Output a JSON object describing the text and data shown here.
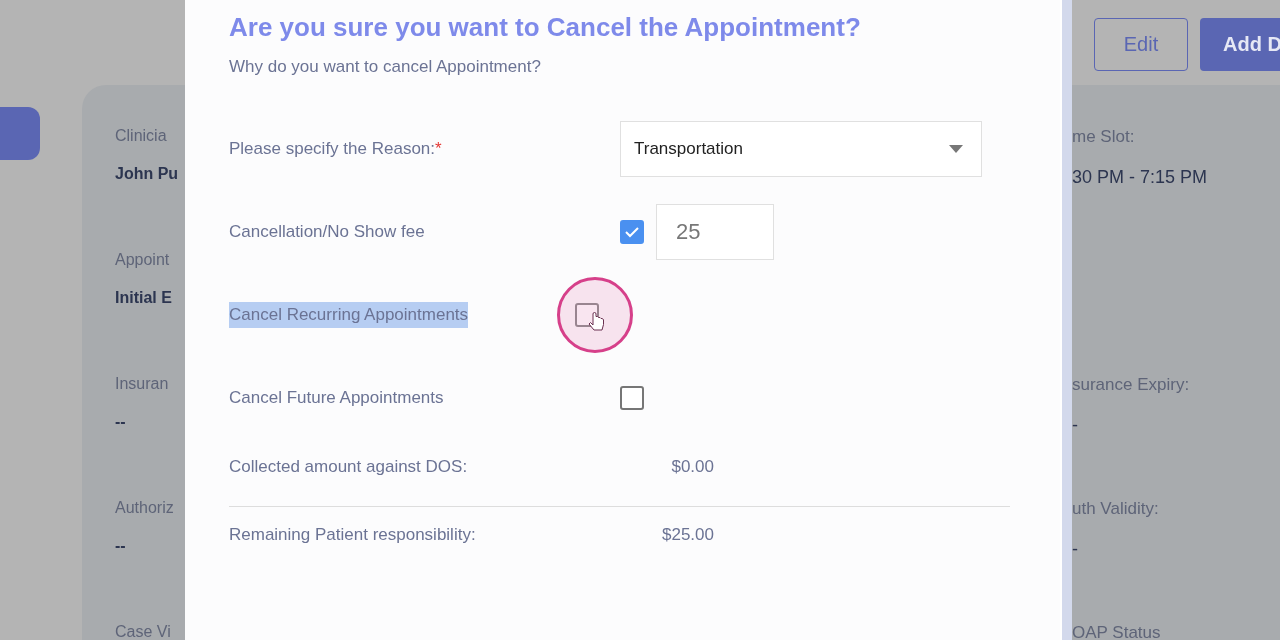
{
  "header_buttons": [
    {
      "label": "Edit",
      "kind": "outline"
    },
    {
      "label": "Add D",
      "kind": "primary"
    }
  ],
  "card_left": [
    {
      "label": "Clinicia",
      "value": "John Pu"
    },
    {
      "label": "Appoint",
      "value": "Initial E"
    },
    {
      "label": "Insuran",
      "value": "--"
    },
    {
      "label": "Authoriz",
      "value": "--"
    },
    {
      "label": "Case Vi"
    }
  ],
  "card_right": [
    {
      "label": "me Slot:",
      "value": "30 PM - 7:15 PM"
    },
    {
      "label": "surance Expiry:",
      "value": "-"
    },
    {
      "label": "uth Validity:",
      "value": "-"
    },
    {
      "label": "OAP Status"
    }
  ],
  "dialog": {
    "title": "Are you sure you want to Cancel the Appointment?",
    "subtitle": "Why do you want to cancel Appointment?",
    "fields": [
      {
        "kind": "select",
        "label": "Please specify the Reason:",
        "required_mark": "*",
        "value": "Transportation"
      },
      {
        "kind": "checkbox_input",
        "label": "Cancellation/No Show fee",
        "checked": true,
        "value": "25"
      },
      {
        "kind": "checkbox",
        "label": "Cancel Recurring Appointments",
        "checked": false,
        "highlighted": true
      },
      {
        "kind": "checkbox",
        "label": "Cancel Future Appointments",
        "checked": false,
        "highlighted": false
      }
    ],
    "amounts": [
      {
        "label": "Collected amount against DOS:",
        "value": "$0.00"
      },
      {
        "label": "Remaining Patient responsibility:",
        "value": "$25.00"
      }
    ]
  }
}
